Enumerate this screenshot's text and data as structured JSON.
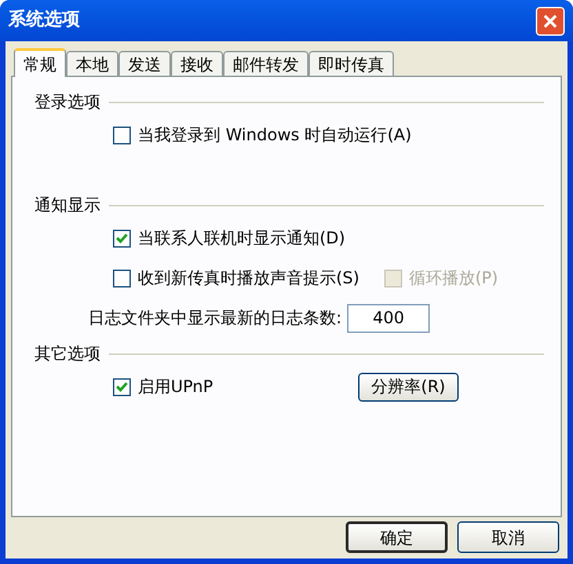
{
  "window": {
    "title": "系统选项"
  },
  "tabs": [
    {
      "label": "常规",
      "selected": true
    },
    {
      "label": "本地",
      "selected": false
    },
    {
      "label": "发送",
      "selected": false
    },
    {
      "label": "接收",
      "selected": false
    },
    {
      "label": "邮件转发",
      "selected": false
    },
    {
      "label": "即时传真",
      "selected": false
    }
  ],
  "groups": [
    {
      "title": "登录选项",
      "rows": [
        [
          {
            "kind": "checkbox",
            "label": "当我登录到 Windows 时自动运行(A)",
            "checked": false,
            "disabled": false
          }
        ]
      ]
    },
    {
      "title": "通知显示",
      "rows": [
        [
          {
            "kind": "checkbox",
            "label": "当联系人联机时显示通知(D)",
            "checked": true,
            "disabled": false
          }
        ],
        [
          {
            "kind": "checkbox",
            "label": "收到新传真时播放声音提示(S)",
            "checked": false,
            "disabled": false
          },
          {
            "kind": "checkbox",
            "label": "循环播放(P)",
            "checked": false,
            "disabled": true
          }
        ],
        [
          {
            "kind": "field",
            "label": "日志文件夹中显示最新的日志条数:",
            "value": "400"
          }
        ]
      ]
    },
    {
      "title": "其它选项",
      "rows": [
        [
          {
            "kind": "checkbox",
            "label": "启用UPnP",
            "checked": true,
            "disabled": false
          },
          {
            "kind": "button",
            "label": "分辨率(R)"
          }
        ]
      ]
    }
  ],
  "buttons": [
    {
      "label": "确定",
      "default": true
    },
    {
      "label": "取消",
      "default": false
    }
  ]
}
